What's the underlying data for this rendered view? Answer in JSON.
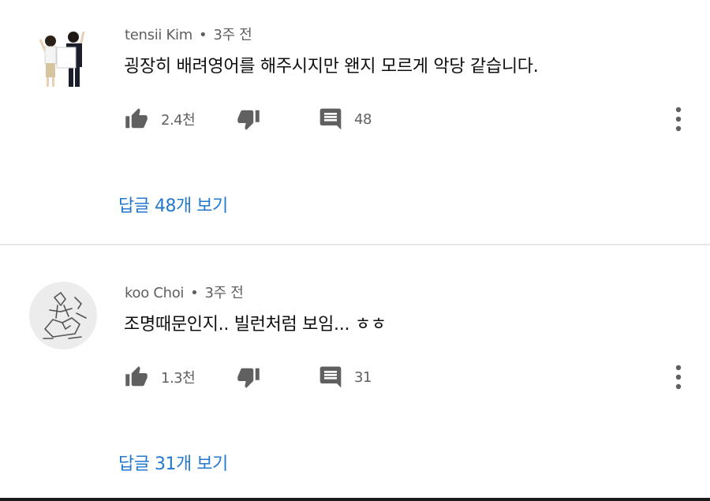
{
  "comments": [
    {
      "author": "tensii Kim",
      "separator": "•",
      "time": "3주 전",
      "text": "굉장히 배려영어를 해주시지만 왠지 모르게 악당 같습니다.",
      "likes": "2.4천",
      "replies_count": "48",
      "view_replies": "답글 48개 보기",
      "avatar": "two-people-photo-avatar"
    },
    {
      "author": "koo Choi",
      "separator": "•",
      "time": "3주 전",
      "text": "조명때문인지.. 빌런처럼 보임... ㅎㅎ",
      "likes": "1.3천",
      "replies_count": "31",
      "view_replies": "답글 31개 보기",
      "avatar": "doodle-drawing-avatar"
    }
  ],
  "icons": {
    "like": "thumb-up-icon",
    "dislike": "thumb-down-icon",
    "reply": "comment-icon",
    "more": "more-vertical-icon"
  },
  "colors": {
    "link": "#2478ce",
    "meta": "#606060",
    "icon": "#606060",
    "text": "#0f0f0f"
  }
}
